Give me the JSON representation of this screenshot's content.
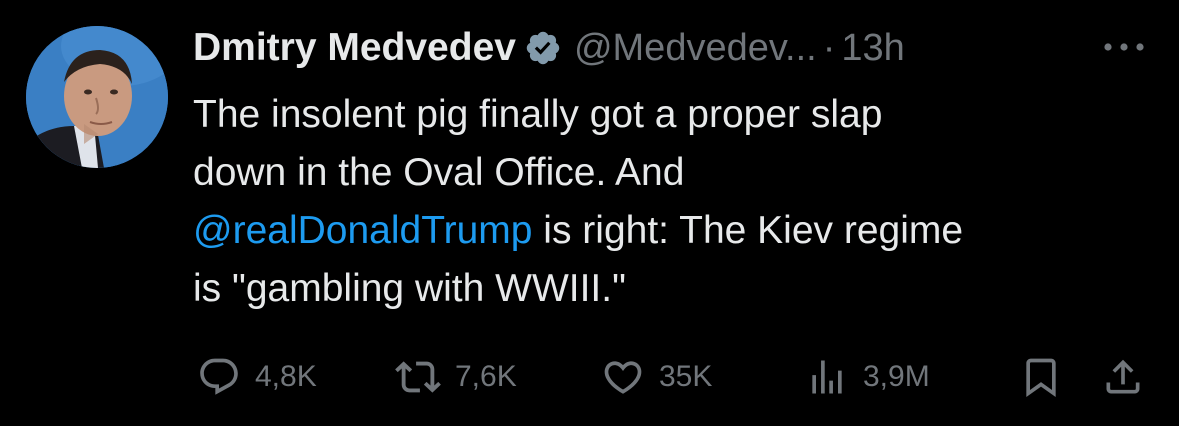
{
  "tweet": {
    "author": {
      "display_name": "Dmitry Medvedev",
      "handle": "@Medvedev...",
      "verified_icon": "verified-badge-icon",
      "avatar_icon": "avatar"
    },
    "separator": "·",
    "time": "13h",
    "more_icon": "more-icon",
    "text": {
      "line1": "The insolent pig finally got a proper slap",
      "line2": "down in the Oval Office. And",
      "mention": "@realDonaldTrump",
      "line3_rest": " is right: The Kiev regime",
      "line4": "is \"gambling with WWIII.\""
    },
    "actions": {
      "reply": {
        "icon": "reply-icon",
        "count": "4,8K"
      },
      "retweet": {
        "icon": "retweet-icon",
        "count": "7,6K"
      },
      "like": {
        "icon": "heart-icon",
        "count": "35K"
      },
      "views": {
        "icon": "views-icon",
        "count": "3,9M"
      },
      "bookmark": {
        "icon": "bookmark-icon"
      },
      "share": {
        "icon": "share-icon"
      }
    }
  },
  "colors": {
    "background": "#000000",
    "text": "#e7e9ea",
    "muted": "#71767b",
    "link": "#1d9bf0",
    "avatar_bg": "#3a7fc4"
  }
}
